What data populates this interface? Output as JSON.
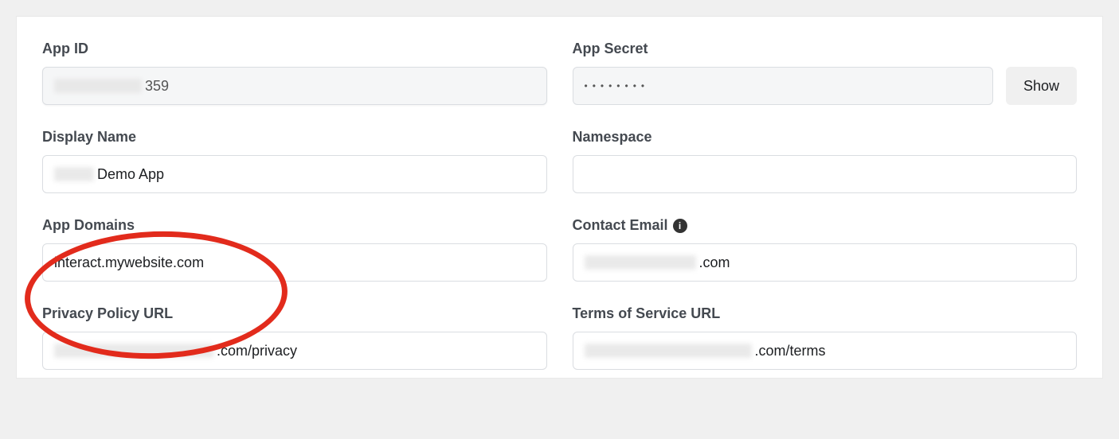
{
  "fields": {
    "app_id": {
      "label": "App ID",
      "value_suffix": "359"
    },
    "app_secret": {
      "label": "App Secret",
      "masked": "••••••••",
      "show_button": "Show"
    },
    "display_name": {
      "label": "Display Name",
      "value_suffix": "Demo App"
    },
    "namespace": {
      "label": "Namespace",
      "value": ""
    },
    "app_domains": {
      "label": "App Domains",
      "value": "interact.mywebsite.com"
    },
    "contact_email": {
      "label": "Contact Email",
      "value_suffix": ".com"
    },
    "privacy_policy": {
      "label": "Privacy Policy URL",
      "value_suffix": ".com/privacy"
    },
    "terms_of_service": {
      "label": "Terms of Service URL",
      "value_suffix": ".com/terms"
    }
  },
  "annotation": {
    "highlight": "app_domains"
  }
}
